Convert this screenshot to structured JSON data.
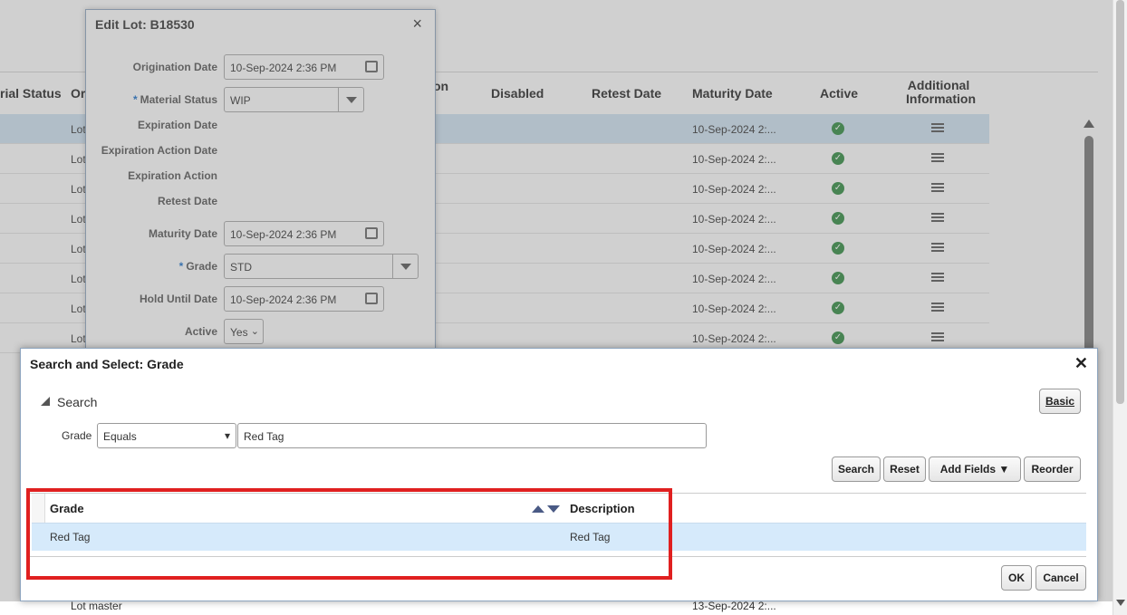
{
  "background_table": {
    "headers": {
      "material_status": "rial Status",
      "origin_partial": "Or",
      "expiration_partial": "on",
      "disabled": "Disabled",
      "retest_date": "Retest Date",
      "maturity_date": "Maturity Date",
      "active": "Active",
      "additional_info": "Additional Information"
    },
    "rows": [
      {
        "origin": "Lot",
        "maturity": "10-Sep-2024 2:..."
      },
      {
        "origin": "Lot",
        "maturity": "10-Sep-2024 2:..."
      },
      {
        "origin": "Lot",
        "maturity": "10-Sep-2024 2:..."
      },
      {
        "origin": "Lot",
        "maturity": "10-Sep-2024 2:..."
      },
      {
        "origin": "Lot",
        "maturity": "10-Sep-2024 2:..."
      },
      {
        "origin": "Lot",
        "maturity": "10-Sep-2024 2:..."
      },
      {
        "origin": "Lot",
        "maturity": "10-Sep-2024 2:..."
      },
      {
        "origin": "Lot",
        "maturity": "10-Sep-2024 2:..."
      }
    ],
    "last_row": {
      "origin": "Lot master",
      "maturity": "13-Sep-2024 2:..."
    }
  },
  "edit_dialog": {
    "title": "Edit Lot: B18530",
    "fields": {
      "origination_date": {
        "label": "Origination Date",
        "value": "10-Sep-2024 2:36 PM"
      },
      "material_status": {
        "label": "Material Status",
        "value": "WIP"
      },
      "expiration_date": {
        "label": "Expiration Date"
      },
      "expiration_action_date": {
        "label": "Expiration Action Date"
      },
      "expiration_action": {
        "label": "Expiration Action"
      },
      "retest_date": {
        "label": "Retest Date"
      },
      "maturity_date": {
        "label": "Maturity Date",
        "value": "10-Sep-2024 2:36 PM"
      },
      "grade": {
        "label": "Grade",
        "value": "STD"
      },
      "hold_until_date": {
        "label": "Hold Until Date",
        "value": "10-Sep-2024 2:36 PM"
      },
      "active": {
        "label": "Active",
        "value": "Yes"
      }
    }
  },
  "search_dialog": {
    "title": "Search and Select: Grade",
    "search_section": "Search",
    "basic_button": "Basic",
    "grade_label": "Grade",
    "operator": "Equals",
    "grade_value": "Red Tag",
    "buttons": {
      "search": "Search",
      "reset": "Reset",
      "add_fields": "Add Fields",
      "reorder": "Reorder",
      "ok": "OK",
      "cancel": "Cancel"
    },
    "results": {
      "columns": [
        "Grade",
        "Description"
      ],
      "rows": [
        {
          "grade": "Red Tag",
          "description": "Red Tag"
        }
      ]
    }
  },
  "colors": {
    "highlight": "#e02020",
    "selected_row": "#d6eafb",
    "active_check": "#2e8b3f"
  }
}
